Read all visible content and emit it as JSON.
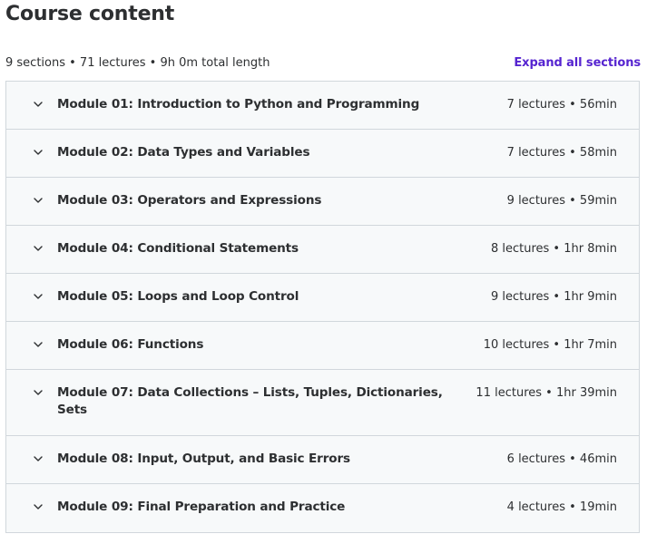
{
  "header": {
    "title": "Course content",
    "summary": "9 sections • 71 lectures • 9h 0m total length",
    "expand_label": "Expand all sections"
  },
  "sections": [
    {
      "title": "Module 01: Introduction to Python and Programming",
      "meta": "7 lectures • 56min"
    },
    {
      "title": "Module 02: Data Types and Variables",
      "meta": "7 lectures • 58min"
    },
    {
      "title": "Module 03: Operators and Expressions",
      "meta": "9 lectures • 59min"
    },
    {
      "title": "Module 04: Conditional Statements",
      "meta": "8 lectures • 1hr 8min"
    },
    {
      "title": "Module 05: Loops and Loop Control",
      "meta": "9 lectures • 1hr 9min"
    },
    {
      "title": "Module 06: Functions",
      "meta": "10 lectures • 1hr 7min"
    },
    {
      "title": "Module 07: Data Collections – Lists, Tuples, Dictionaries, Sets",
      "meta": "11 lectures • 1hr 39min"
    },
    {
      "title": "Module 08: Input, Output, and Basic Errors",
      "meta": "6 lectures • 46min"
    },
    {
      "title": "Module 09: Final Preparation and Practice",
      "meta": "4 lectures • 19min"
    }
  ],
  "colors": {
    "text": "#2d2f31",
    "link": "#5624d0",
    "panel_bg": "#f7f9fa",
    "border": "#d1d7dc"
  },
  "icons": {
    "section_toggle": "chevron-down-icon"
  }
}
